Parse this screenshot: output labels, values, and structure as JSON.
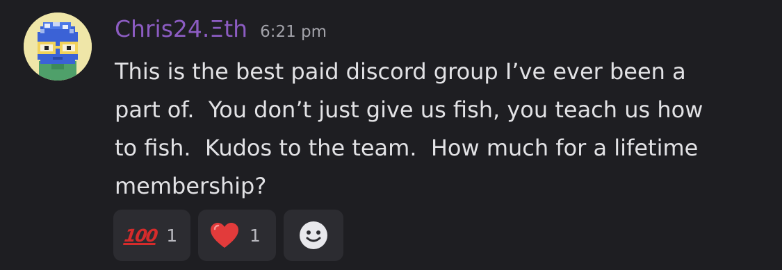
{
  "message": {
    "username": "Chris24.Ξth",
    "timestamp": "6:21 pm",
    "content": "This is the best paid discord group I’ve ever been a\npart of.  You don’t just give us fish, you teach us how\nto fish.  Kudos to the team.  How much for a lifetime\nmembership?"
  },
  "reactions": [
    {
      "emoji": "💯",
      "label": "100",
      "count": "1",
      "icon": "hundred-points-icon"
    },
    {
      "emoji": "❤️",
      "count": "1",
      "icon": "red-heart-icon"
    }
  ],
  "add_reaction": {
    "icon": "smiley-add-reaction-icon"
  },
  "colors": {
    "background": "#1e1e22",
    "username": "#8c5cc2",
    "message_text": "#e2e2e5",
    "timestamp": "#a3a3aa",
    "reaction_bg": "#2c2c31"
  }
}
